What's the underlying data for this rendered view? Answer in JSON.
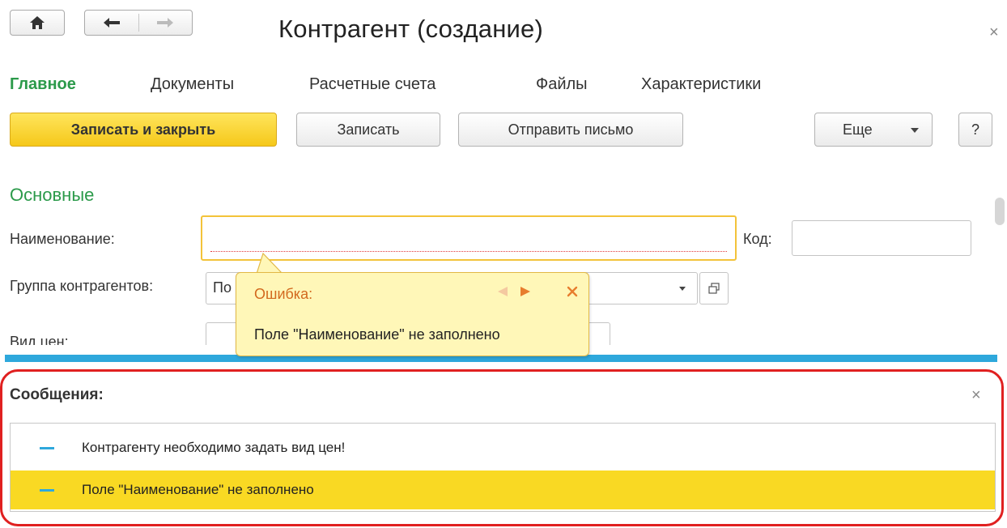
{
  "window": {
    "title": "Контрагент (создание)",
    "close_icon": "×"
  },
  "nav": {
    "home_icon": "home-icon",
    "back_icon": "arrow-left-icon",
    "forward_icon": "arrow-right-icon"
  },
  "tabs": [
    {
      "label": "Главное",
      "active": true
    },
    {
      "label": "Документы"
    },
    {
      "label": "Расчетные счета"
    },
    {
      "label": "Файлы"
    },
    {
      "label": "Характеристики"
    }
  ],
  "toolbar": {
    "save_close_label": "Записать и закрыть",
    "save_label": "Записать",
    "send_letter_label": "Отправить письмо",
    "more_label": "Еще",
    "help_label": "?"
  },
  "form": {
    "section_title": "Основные",
    "name_label": "Наименование:",
    "name_value": "",
    "code_label": "Код:",
    "code_value": "",
    "group_label": "Группа контрагентов:",
    "group_value": "По",
    "price_kind_label": "Вид цен:"
  },
  "tooltip": {
    "title": "Ошибка:",
    "message": "Поле \"Наименование\" не заполнено"
  },
  "messages": {
    "title": "Сообщения:",
    "close_icon": "×",
    "items": [
      {
        "text": "Контрагенту необходимо задать вид цен!",
        "selected": false
      },
      {
        "text": "Поле \"Наименование\" не заполнено",
        "selected": true
      }
    ]
  },
  "colors": {
    "accent_green": "#2b9a4a",
    "primary_yellow": "#f5c81a",
    "selection_yellow": "#f9d923",
    "blue_bar": "#2ea8dc",
    "error_red": "#e02020"
  }
}
